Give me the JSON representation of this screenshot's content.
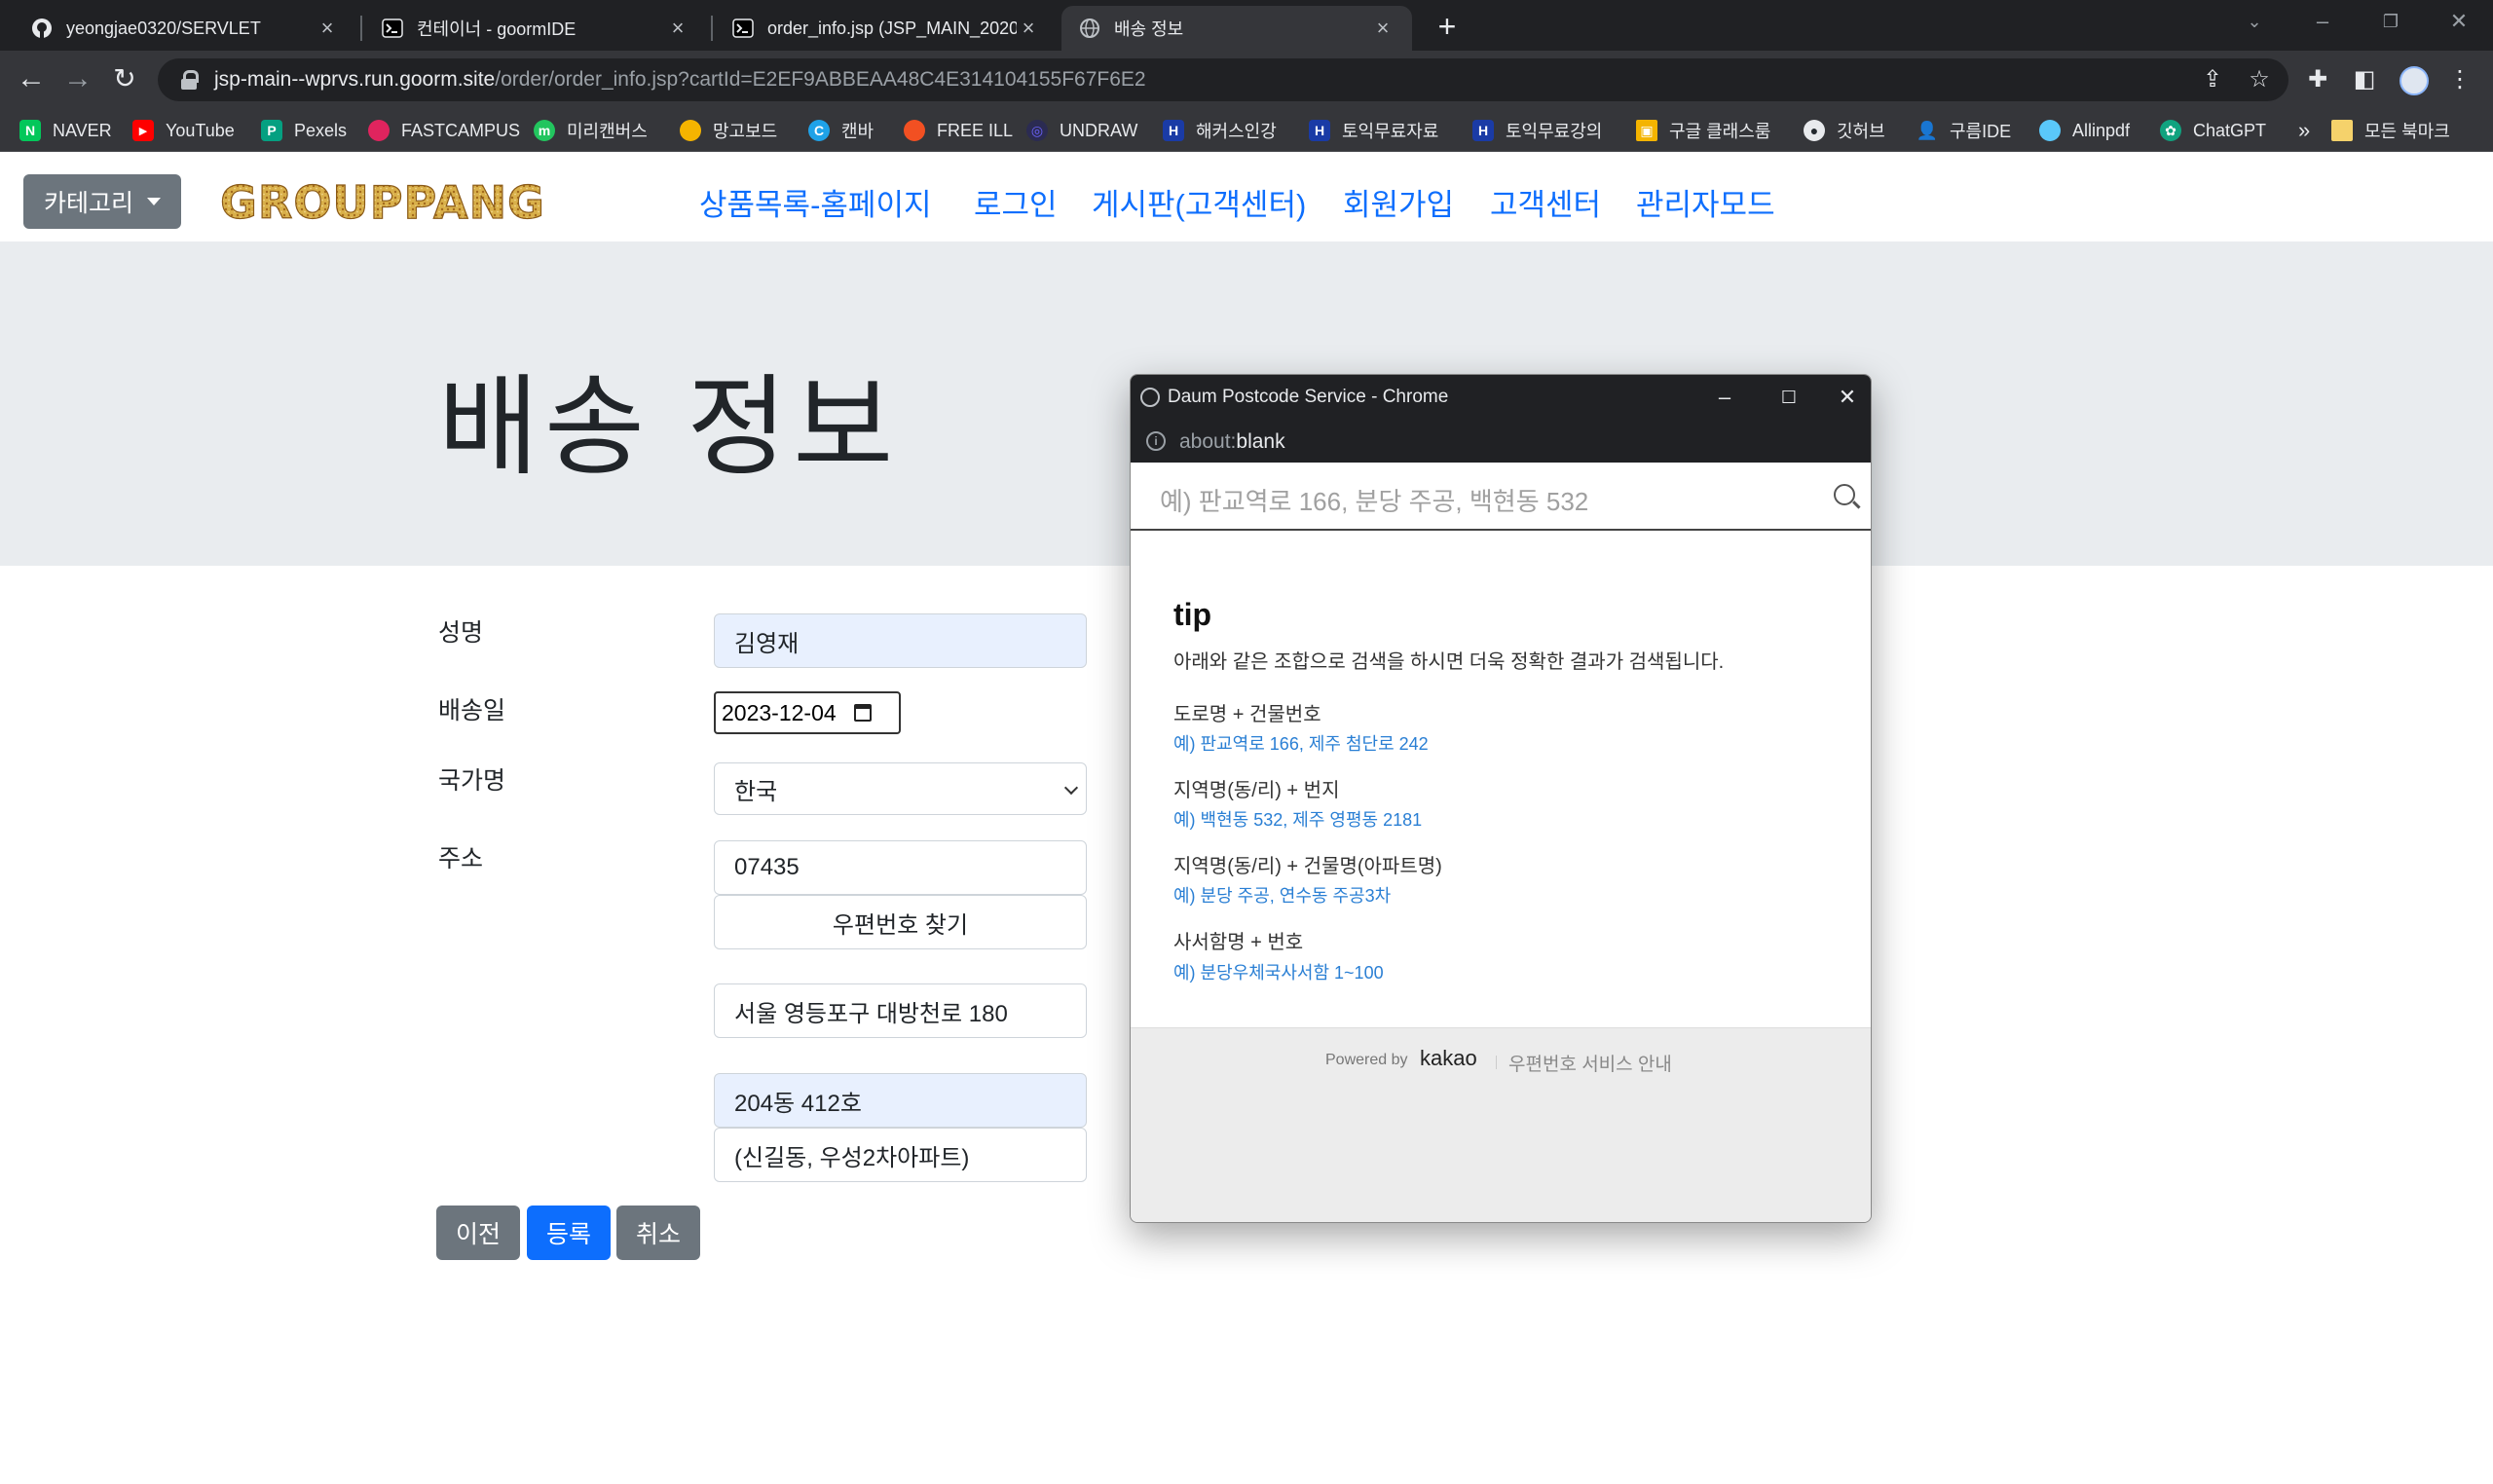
{
  "browser": {
    "tabs": [
      {
        "title": "yeongjae0320/SERVLET",
        "icon": "github-icon"
      },
      {
        "title": "컨테이너 - goormIDE",
        "icon": "terminal-icon"
      },
      {
        "title": "order_info.jsp (JSP_MAIN_2020",
        "icon": "terminal-icon"
      },
      {
        "title": "배송 정보",
        "icon": "globe-icon"
      }
    ],
    "url_host": "jsp-main--wprvs.run.goorm.site",
    "url_path": "/order/order_info.jsp?cartId=E2EF9ABBEAA48C4E314104155F67F6E2",
    "bookmarks": [
      {
        "label": "NAVER",
        "color": "#03c75a",
        "glyph": "N"
      },
      {
        "label": "YouTube",
        "color": "#ff0000",
        "glyph": "▶"
      },
      {
        "label": "Pexels",
        "color": "#05a081",
        "glyph": "P"
      },
      {
        "label": "FASTCAMPUS",
        "color": "#e0245e",
        "glyph": "●"
      },
      {
        "label": "미리캔버스",
        "color": "#22c55e",
        "glyph": "m"
      },
      {
        "label": "망고보드",
        "color": "#f5b400",
        "glyph": "●"
      },
      {
        "label": "캔바",
        "color": "#1fa2e8",
        "glyph": "C"
      },
      {
        "label": "FREE ILL",
        "color": "#f25022",
        "glyph": "●"
      },
      {
        "label": "UNDRAW",
        "color": "#6c63ff",
        "glyph": "◎"
      },
      {
        "label": "해커스인강",
        "color": "#1a3ba6",
        "glyph": "H"
      },
      {
        "label": "토익무료자료",
        "color": "#1a3ba6",
        "glyph": "H"
      },
      {
        "label": "토익무료강의",
        "color": "#1a3ba6",
        "glyph": "H"
      },
      {
        "label": "구글 클래스룸",
        "color": "#f4b400",
        "glyph": "▣"
      },
      {
        "label": "깃허브",
        "color": "#24292f",
        "glyph": "●"
      },
      {
        "label": "구름IDE",
        "color": "#5f6368",
        "glyph": "●"
      },
      {
        "label": "Allinpdf",
        "color": "#5ac8fa",
        "glyph": "◎"
      },
      {
        "label": "ChatGPT",
        "color": "#10a37f",
        "glyph": "✿"
      }
    ],
    "bookmarks_overflow": "»",
    "all_bookmarks": "모든 북마크"
  },
  "navbar": {
    "category_label": "카테고리",
    "logo_text": "GROUPPANG",
    "links": [
      "상품목록-홈페이지",
      "로그인",
      "게시판(고객센터)",
      "회원가입",
      "고객센터",
      "관리자모드"
    ]
  },
  "jumbotron": {
    "title": "배송 정보"
  },
  "form": {
    "name_label": "성명",
    "name_value": "김영재",
    "date_label": "배송일",
    "date_value": "2023-12-04",
    "country_label": "국가명",
    "country_value": "한국",
    "address_label": "주소",
    "zipcode": "07435",
    "zip_search_button": "우편번호 찾기",
    "address1": "서울 영등포구 대방천로 180",
    "address2": "204동 412호",
    "address_extra": "(신길동, 우성2차아파트)",
    "prev_button": "이전",
    "submit_button": "등록",
    "cancel_button": "취소"
  },
  "colors": {
    "primary": "#0d6efd",
    "secondary": "#6c757d",
    "jumbotron_bg": "#e9ecef",
    "autofill_bg": "#e8f0fe"
  },
  "popup": {
    "window_title": "Daum Postcode Service - Chrome",
    "url_prefix": "about:",
    "url_rest": "blank",
    "search_placeholder": "예) 판교역로 166, 분당 주공, 백현동 532",
    "tip_title": "tip",
    "tip_subtitle": "아래와 같은 조합으로 검색을 하시면 더욱 정확한 결과가 검색됩니다.",
    "tips": [
      {
        "heading": "도로명 + 건물번호",
        "example": "예) 판교역로 166,  제주 첨단로 242"
      },
      {
        "heading": "지역명(동/리) + 번지",
        "example": "예) 백현동 532,  제주 영평동 2181"
      },
      {
        "heading": "지역명(동/리) + 건물명(아파트명)",
        "example": "예) 분당 주공,  연수동 주공3차"
      },
      {
        "heading": "사서함명 + 번호",
        "example": "예) 분당우체국사서함 1~100"
      }
    ],
    "powered_by": "Powered by",
    "kakao": "kakao",
    "service_guide": "우편번호 서비스 안내"
  }
}
